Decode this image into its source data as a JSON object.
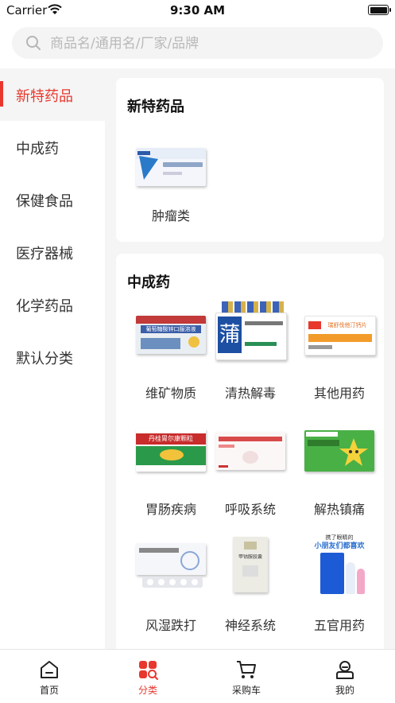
{
  "status_bar": {
    "carrier": "Carrier",
    "time": "9:30 AM"
  },
  "search": {
    "placeholder": "商品名/通用名/厂家/品牌"
  },
  "sidebar": {
    "items": [
      {
        "label": "新特药品",
        "active": true
      },
      {
        "label": "中成药"
      },
      {
        "label": "保健食品"
      },
      {
        "label": "医疗器械"
      },
      {
        "label": "化学药品"
      },
      {
        "label": "默认分类"
      }
    ]
  },
  "sections": [
    {
      "title": "新特药品",
      "items": [
        {
          "label": "肿瘤类",
          "icon": "tumor-medicine-box"
        }
      ]
    },
    {
      "title": "中成药",
      "items": [
        {
          "label": "维矿物质",
          "icon": "vitamin-mineral-box"
        },
        {
          "label": "清热解毒",
          "icon": "heat-clearing-box"
        },
        {
          "label": "其他用药",
          "icon": "other-medicine-box"
        },
        {
          "label": "胃肠疾病",
          "icon": "gastrointestinal-box"
        },
        {
          "label": "呼吸系统",
          "icon": "respiratory-box"
        },
        {
          "label": "解热镇痛",
          "icon": "antipyretic-box"
        },
        {
          "label": "风湿跌打",
          "icon": "rheumatism-box"
        },
        {
          "label": "神经系统",
          "icon": "nervous-system-box"
        },
        {
          "label": "五官用药",
          "icon": "ent-medicine-box"
        }
      ]
    }
  ],
  "tabbar": {
    "items": [
      {
        "label": "首页",
        "icon": "home-icon"
      },
      {
        "label": "分类",
        "icon": "category-icon",
        "active": true
      },
      {
        "label": "采购车",
        "icon": "cart-icon"
      },
      {
        "label": "我的",
        "icon": "profile-icon"
      }
    ]
  },
  "colors": {
    "accent": "#e8372d",
    "background": "#f5f5f5",
    "card": "#ffffff"
  },
  "box_pictures": {
    "vitamin": "葡萄糖酸锌口服溶液",
    "heat": "蒲",
    "other": "瑞舒伐他汀钙片",
    "gastro": "丹桂胃尔康颗粒",
    "nerve": "甲钴胺胶囊",
    "ent_top": "携了眼睛的",
    "ent_slogan": "小朋友们都喜欢"
  }
}
